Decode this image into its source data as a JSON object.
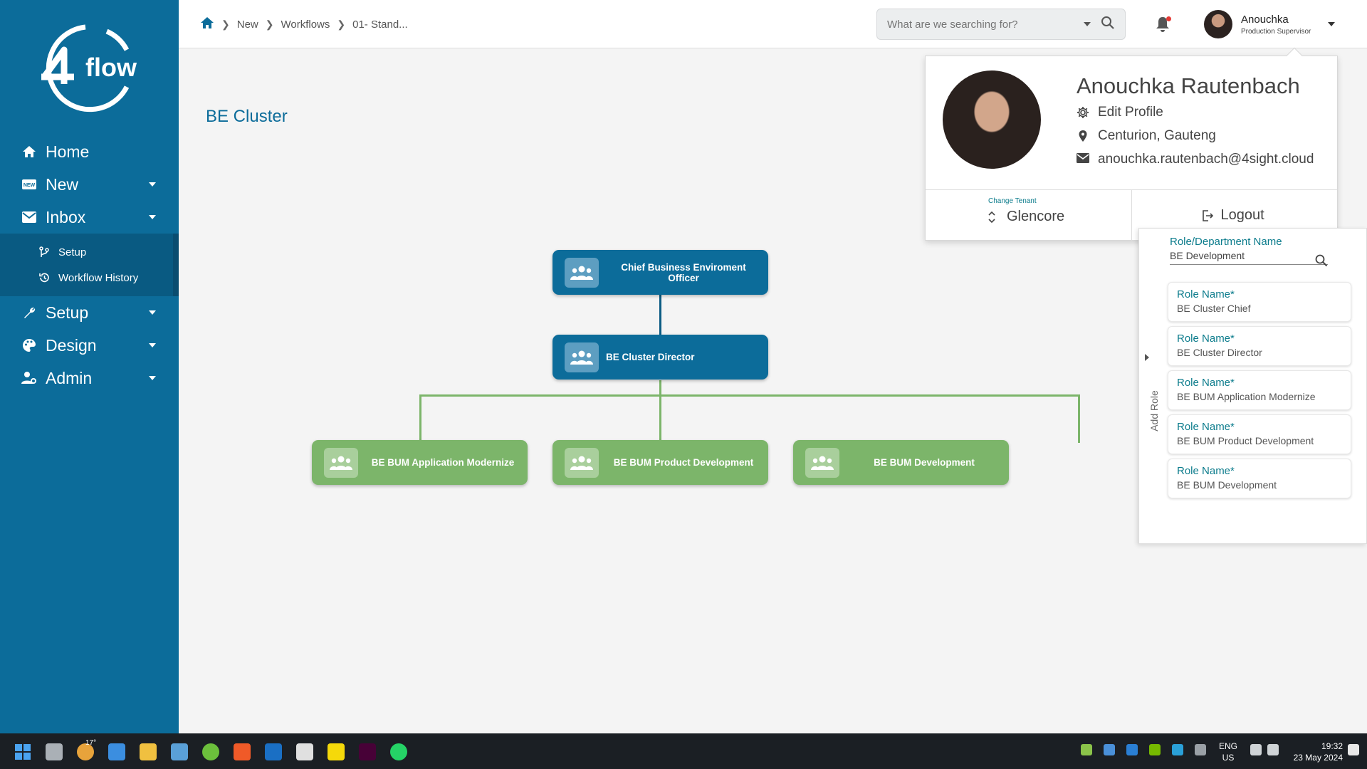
{
  "sidebar": {
    "logo_text": "flow",
    "items": [
      {
        "label": "Home"
      },
      {
        "label": "New"
      },
      {
        "label": "Inbox"
      },
      {
        "label": "Setup"
      },
      {
        "label": "Design"
      },
      {
        "label": "Admin"
      }
    ],
    "subitems": [
      {
        "label": "Setup"
      },
      {
        "label": "Workflow History"
      }
    ]
  },
  "breadcrumb": {
    "items": [
      "New",
      "Workflows",
      "01- Stand..."
    ]
  },
  "search": {
    "placeholder": "What are we searching for?"
  },
  "user": {
    "name": "Anouchka",
    "role": "Production Supervisor"
  },
  "page": {
    "title": "BE Cluster"
  },
  "org": {
    "root": "Chief Business Enviroment Officer",
    "director": "BE Cluster Director",
    "children": [
      "BE BUM Application Modernize",
      "BE BUM Product Development",
      "BE BUM Development"
    ]
  },
  "profile": {
    "full_name": "Anouchka Rautenbach",
    "edit_label": "Edit Profile",
    "location": "Centurion, Gauteng",
    "email": "anouchka.rautenbach@4sight.cloud",
    "tenant_label": "Change Tenant",
    "tenant_value": "Glencore",
    "logout_label": "Logout"
  },
  "role_panel": {
    "add_label": "Add Role",
    "field_label": "Role/Department Name",
    "field_value": "BE Development",
    "cards": [
      {
        "label": "Role Name*",
        "value": "BE Cluster Chief"
      },
      {
        "label": "Role Name*",
        "value": "BE Cluster Director"
      },
      {
        "label": "Role Name*",
        "value": "BE BUM Application Modernize"
      },
      {
        "label": "Role Name*",
        "value": "BE BUM Product Development"
      },
      {
        "label": "Role Name*",
        "value": "BE BUM Development"
      }
    ]
  },
  "taskbar": {
    "weather": "17°",
    "lang": "ENG",
    "region": "US",
    "time": "19:32",
    "date": "23 May 2024"
  },
  "colors": {
    "primary": "#0c6c9a",
    "green": "#7cb56a",
    "accent": "#0c7c8c"
  }
}
